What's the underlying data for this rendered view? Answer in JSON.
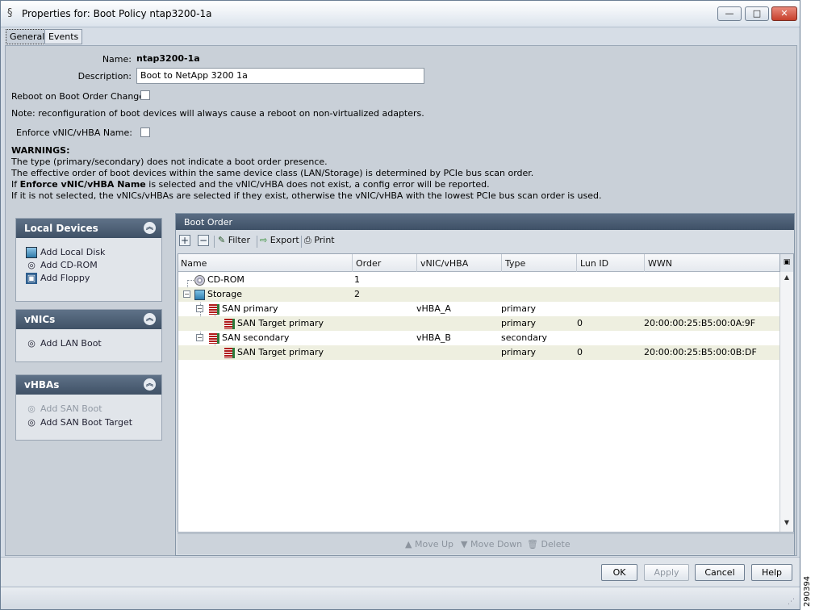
{
  "window": {
    "title": "Properties for: Boot Policy ntap3200-1a",
    "min_glyph": "—",
    "max_glyph": "□",
    "close_glyph": "✕"
  },
  "tabs": [
    {
      "label": "General"
    },
    {
      "label": "Events"
    }
  ],
  "form": {
    "name_label": "Name:",
    "name_value": "ntap3200-1a",
    "description_label": "Description:",
    "description_value": "Boot to NetApp 3200 1a",
    "reboot_label": "Reboot on Boot Order Change:",
    "reboot_checked": false,
    "note": "Note: reconfiguration of boot devices will always cause a reboot on non-virtualized adapters.",
    "enforce_label": "Enforce vNIC/vHBA Name:",
    "enforce_checked": false
  },
  "warnings": {
    "heading": "WARNINGS:",
    "line1": "The type (primary/secondary) does not indicate a boot order presence.",
    "line2": "The effective order of boot devices within the same device class (LAN/Storage) is determined by PCIe bus scan order.",
    "line3_prefix": "If ",
    "line3_bold": "Enforce vNIC/vHBA Name",
    "line3_suffix": " is selected and the vNIC/vHBA does not exist, a config error will be reported.",
    "line4": "If it is not selected, the vNICs/vHBAs are selected if they exist, otherwise the vNIC/vHBA with the lowest PCIe bus scan order is used."
  },
  "local_devices": {
    "title": "Local Devices",
    "items": [
      "Add Local Disk",
      "Add CD-ROM",
      "Add Floppy"
    ]
  },
  "vnics": {
    "title": "vNICs",
    "items": [
      "Add LAN Boot"
    ]
  },
  "vhbas": {
    "title": "vHBAs",
    "items": [
      "Add SAN Boot",
      "Add SAN Boot Target"
    ]
  },
  "boot_order": {
    "title": "Boot Order",
    "toolbar": {
      "add": "+",
      "remove": "−",
      "filter": "Filter",
      "export": "Export",
      "print": "Print"
    },
    "columns": [
      "Name",
      "Order",
      "vNIC/vHBA",
      "Type",
      "Lun ID",
      "WWN"
    ],
    "rows": [
      {
        "name": "CD-ROM",
        "order": "1",
        "vnic": "",
        "type": "",
        "lun": "",
        "wwn": ""
      },
      {
        "name": "Storage",
        "order": "2",
        "vnic": "",
        "type": "",
        "lun": "",
        "wwn": ""
      },
      {
        "name": "SAN primary",
        "order": "",
        "vnic": "vHBA_A",
        "type": "primary",
        "lun": "",
        "wwn": ""
      },
      {
        "name": "SAN Target primary",
        "order": "",
        "vnic": "",
        "type": "primary",
        "lun": "0",
        "wwn": "20:00:00:25:B5:00:0A:9F"
      },
      {
        "name": "SAN secondary",
        "order": "",
        "vnic": "vHBA_B",
        "type": "secondary",
        "lun": "",
        "wwn": ""
      },
      {
        "name": "SAN Target primary",
        "order": "",
        "vnic": "",
        "type": "primary",
        "lun": "0",
        "wwn": "20:00:00:25:B5:00:0B:DF"
      }
    ],
    "actions": {
      "move_up": "Move Up",
      "move_down": "Move Down",
      "delete": "Delete"
    }
  },
  "footer": {
    "ok": "OK",
    "apply": "Apply",
    "cancel": "Cancel",
    "help": "Help"
  },
  "side_id": "290394"
}
